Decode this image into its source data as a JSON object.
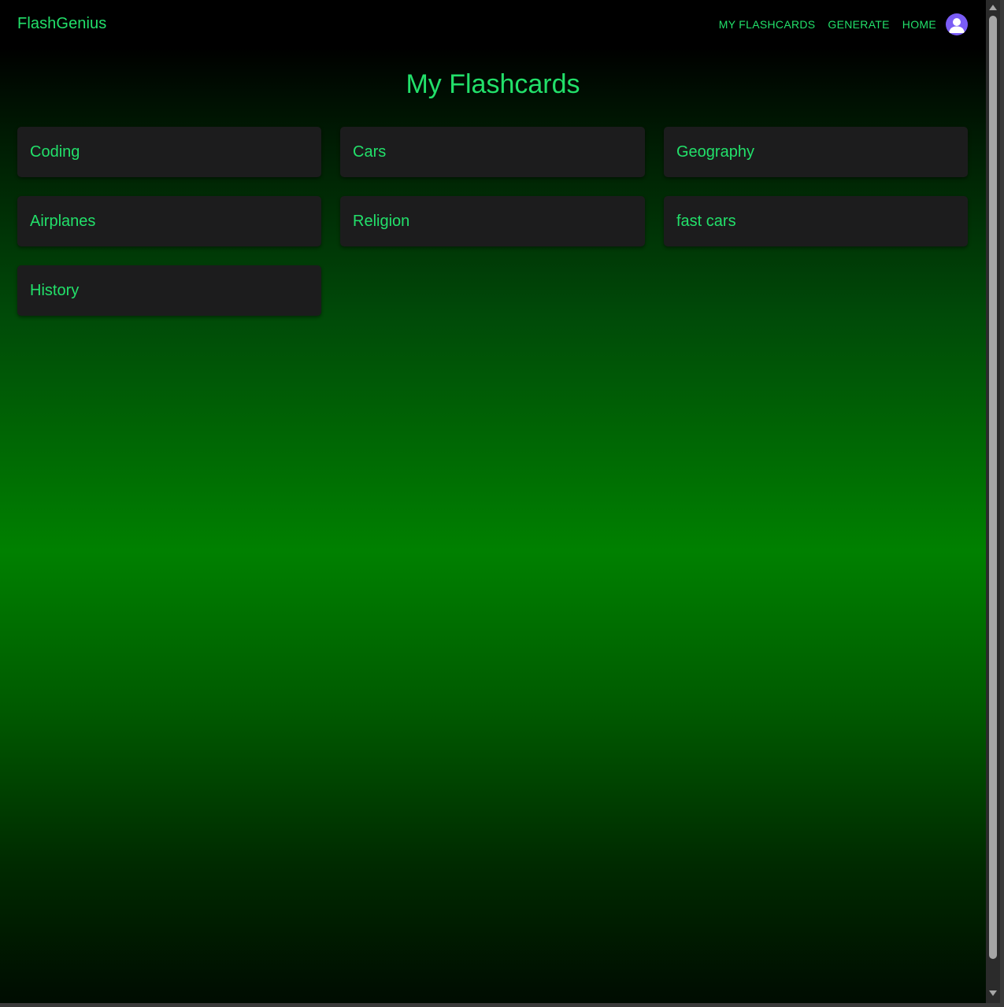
{
  "navbar": {
    "brand": "FlashGenius",
    "links": [
      "MY FLASHCARDS",
      "GENERATE",
      "HOME"
    ],
    "avatar_icon": "user-avatar-icon"
  },
  "main": {
    "title": "My Flashcards",
    "cards": [
      "Coding",
      "Cars",
      "Geography",
      "Airplanes",
      "Religion",
      "fast cars",
      "History"
    ]
  },
  "colors": {
    "accent": "#22e06a",
    "card_bg": "#1c1c1d",
    "navbar_bg": "#000000",
    "gradient_mid": "#008000",
    "avatar_bg": "#7a5cf5"
  }
}
